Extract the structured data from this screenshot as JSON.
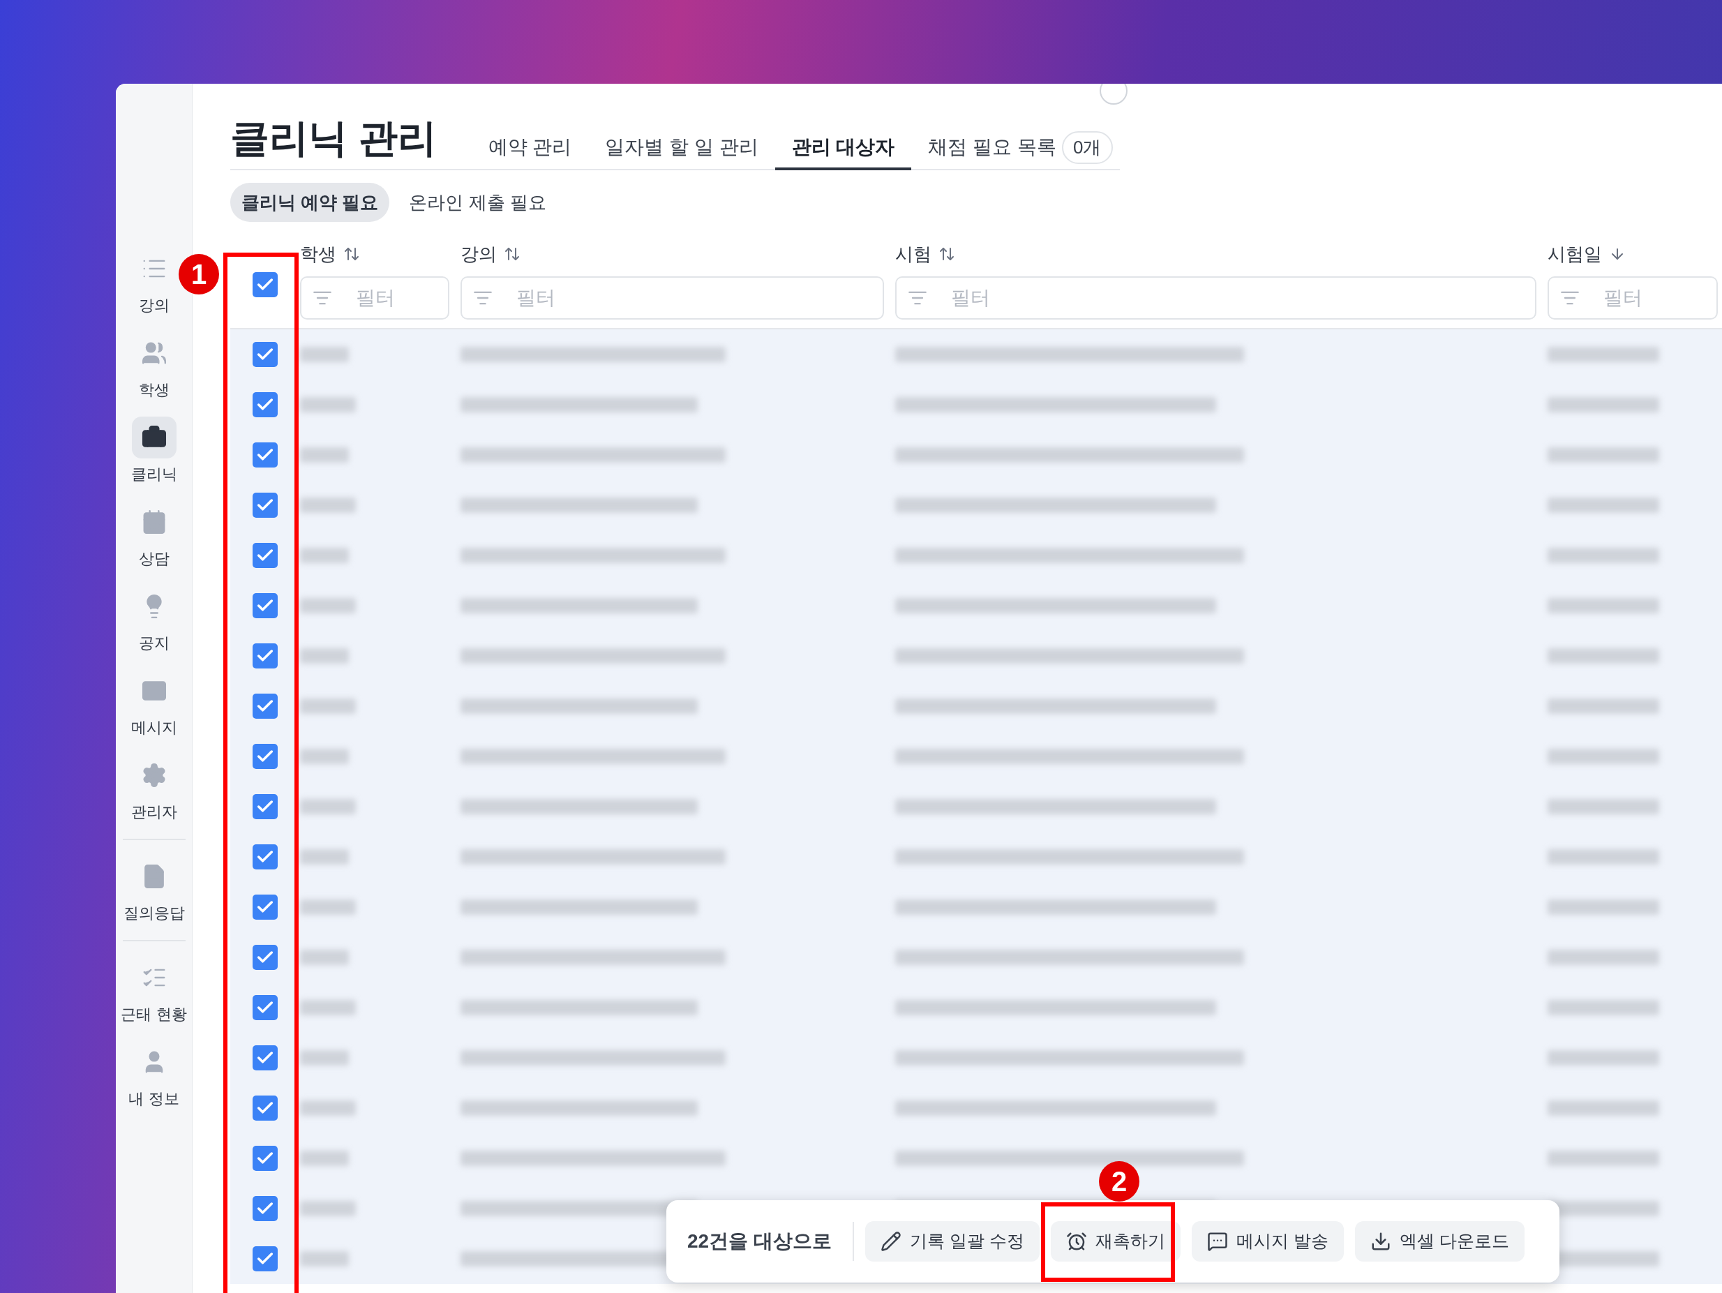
{
  "sidebar": {
    "items": [
      {
        "label": "강의",
        "selected": false
      },
      {
        "label": "학생",
        "selected": false
      },
      {
        "label": "클리닉",
        "selected": true
      },
      {
        "label": "상담",
        "selected": false
      },
      {
        "label": "공지",
        "selected": false
      },
      {
        "label": "메시지",
        "selected": false
      },
      {
        "label": "관리자",
        "selected": false
      },
      {
        "label": "질의응답",
        "selected": false
      },
      {
        "label": "근태 현황",
        "selected": false
      },
      {
        "label": "내 정보",
        "selected": false
      }
    ]
  },
  "page_title": "클리닉 관리",
  "tabs": [
    {
      "label": "예약 관리",
      "selected": false
    },
    {
      "label": "일자별 할 일 관리",
      "selected": false
    },
    {
      "label": "관리 대상자",
      "selected": true
    },
    {
      "label": "채점 필요 목록",
      "selected": false,
      "badge": "0개"
    }
  ],
  "subtabs": [
    {
      "label": "클리닉 예약 필요",
      "selected": true
    },
    {
      "label": "온라인 제출 필요",
      "selected": false
    }
  ],
  "table": {
    "select_all_checked": true,
    "columns": [
      {
        "label": "학생",
        "placeholder": "필터"
      },
      {
        "label": "강의",
        "placeholder": "필터"
      },
      {
        "label": "시험",
        "placeholder": "필터"
      },
      {
        "label": "시험일",
        "placeholder": "필터"
      }
    ],
    "rows": [
      {
        "checked": true
      },
      {
        "checked": true
      },
      {
        "checked": true
      },
      {
        "checked": true
      },
      {
        "checked": true
      },
      {
        "checked": true
      },
      {
        "checked": true
      },
      {
        "checked": true
      },
      {
        "checked": true
      },
      {
        "checked": true
      },
      {
        "checked": true
      },
      {
        "checked": true
      },
      {
        "checked": true
      },
      {
        "checked": true
      },
      {
        "checked": true
      },
      {
        "checked": true
      },
      {
        "checked": true
      },
      {
        "checked": true
      },
      {
        "checked": true
      }
    ]
  },
  "action_bar": {
    "summary": "22건을 대상으로",
    "buttons": [
      {
        "label": "기록 일괄 수정"
      },
      {
        "label": "재촉하기"
      },
      {
        "label": "메시지 발송"
      },
      {
        "label": "엑셀 다운로드"
      }
    ]
  },
  "annotations": [
    "1",
    "2"
  ]
}
